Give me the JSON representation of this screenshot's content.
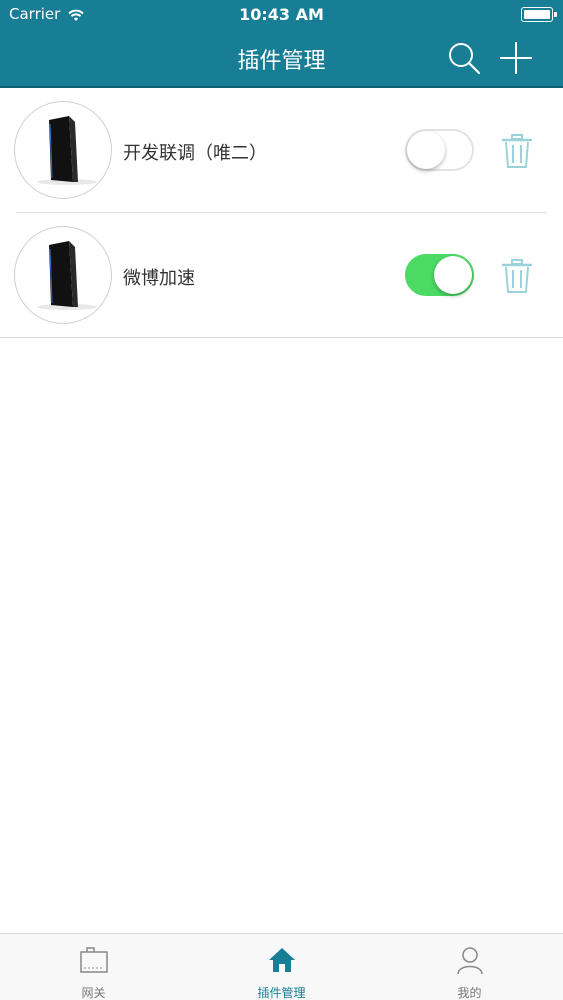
{
  "status_bar": {
    "carrier": "Carrier",
    "time": "10:43 AM"
  },
  "nav": {
    "title": "插件管理",
    "icons": [
      "search-icon",
      "plus-icon"
    ]
  },
  "plugins": [
    {
      "name": "开发联调（唯二）",
      "enabled": false,
      "icon": "router-device-icon"
    },
    {
      "name": "微博加速",
      "enabled": true,
      "icon": "router-device-icon"
    }
  ],
  "tabbar": {
    "tabs": [
      {
        "label": "网关",
        "icon": "gateway-icon",
        "active": false
      },
      {
        "label": "插件管理",
        "icon": "home-icon",
        "active": true
      },
      {
        "label": "我的",
        "icon": "user-icon",
        "active": false
      }
    ]
  },
  "colors": {
    "primary": "#177e96",
    "toggle_on": "#4cd964",
    "trash": "#9bd3dc"
  }
}
